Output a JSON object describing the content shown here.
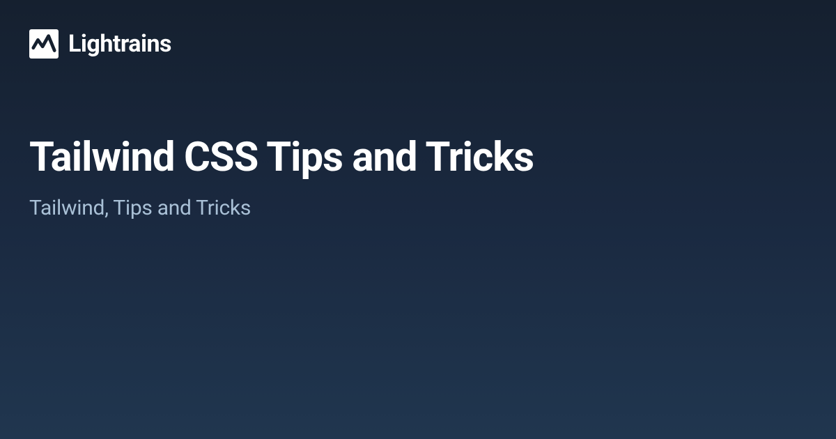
{
  "brand": {
    "name": "Lightrains"
  },
  "page": {
    "title": "Tailwind CSS Tips and Tricks",
    "subtitle": "Tailwind, Tips and Tricks"
  }
}
